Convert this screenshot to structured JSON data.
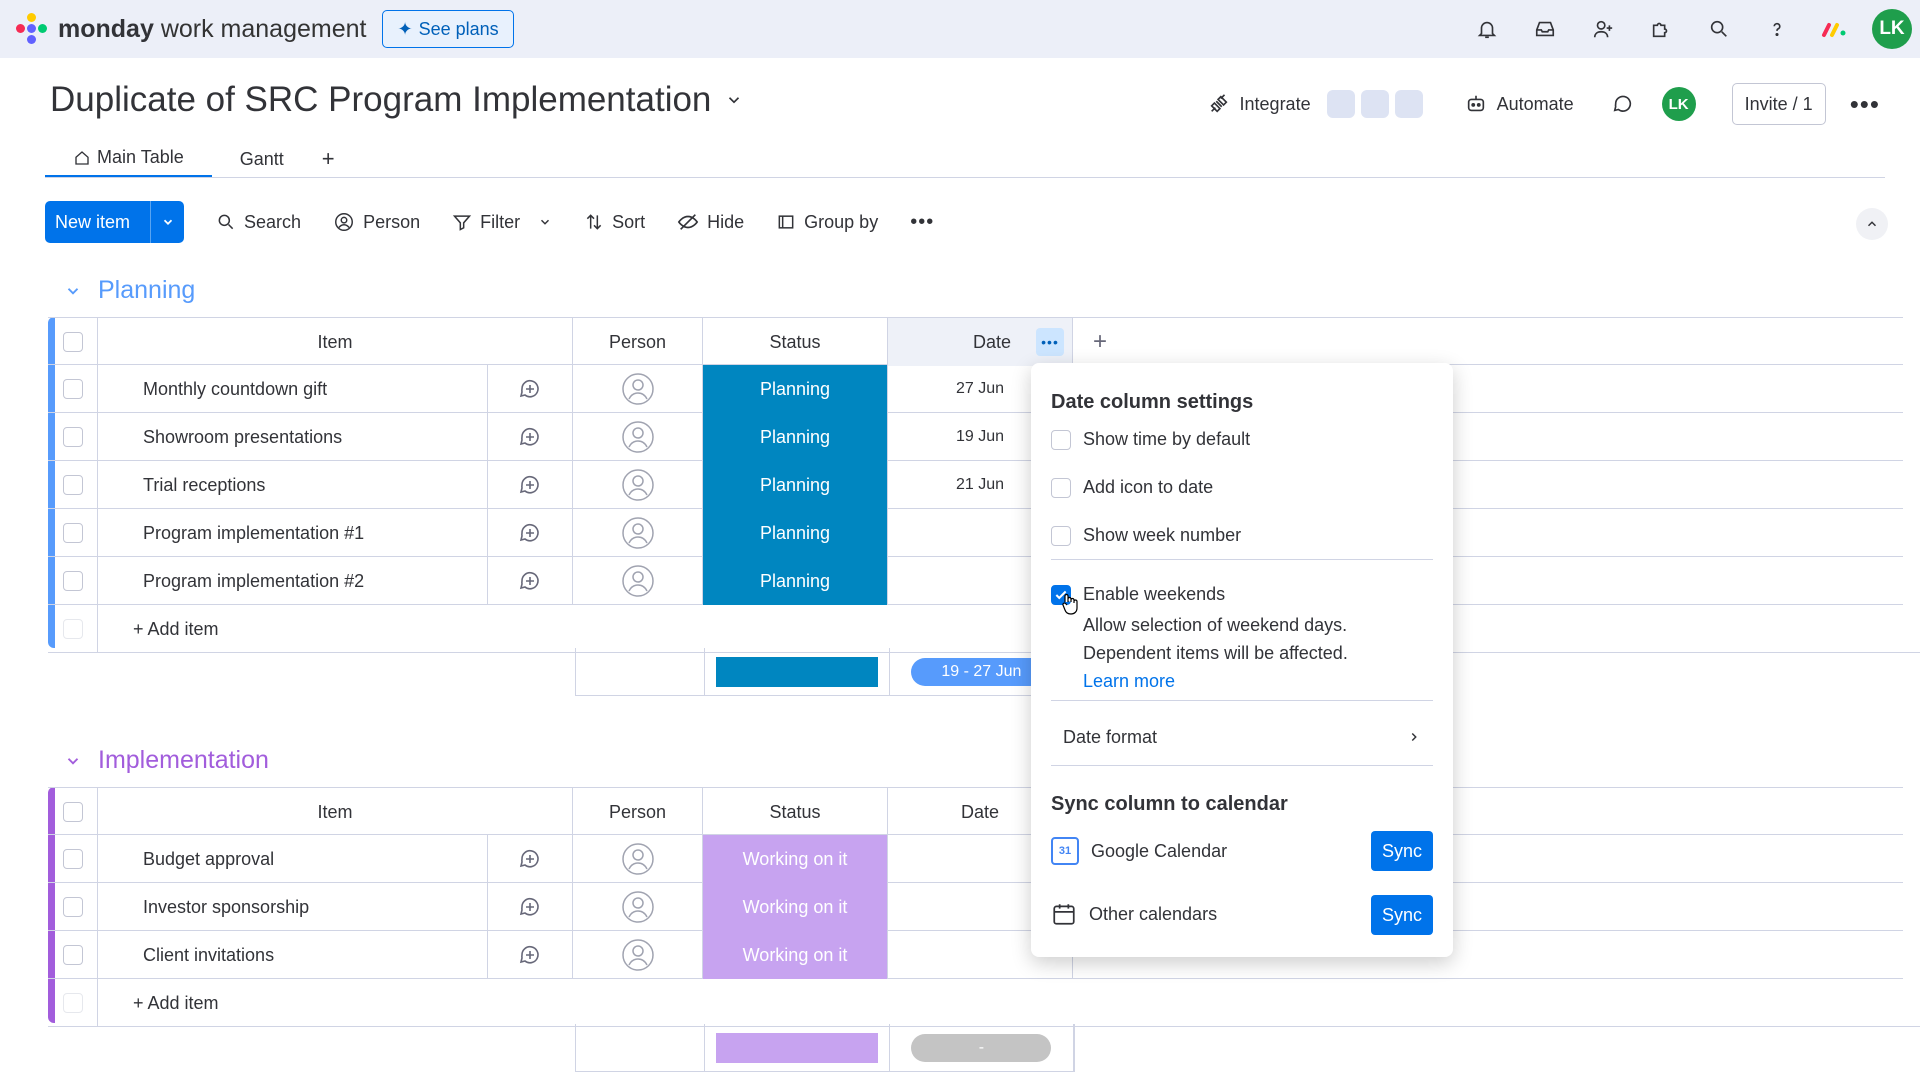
{
  "app": {
    "brand_bold": "monday",
    "brand_rest": "work management",
    "see_plans": "See plans",
    "user_initials": "LK"
  },
  "board": {
    "title": "Duplicate of SRC Program Implementation",
    "integrate": "Integrate",
    "automate": "Automate",
    "invite": "Invite / 1",
    "tabs": [
      {
        "label": "Main Table"
      },
      {
        "label": "Gantt"
      },
      {
        "label": "+"
      }
    ]
  },
  "toolbar": {
    "new_item": "New item",
    "search": "Search",
    "person": "Person",
    "filter": "Filter",
    "sort": "Sort",
    "hide": "Hide",
    "group_by": "Group by"
  },
  "columns": {
    "item": "Item",
    "person": "Person",
    "status": "Status",
    "date": "Date",
    "add": "+"
  },
  "groups": [
    {
      "title": "Planning",
      "color": "#579bfc",
      "rows": [
        {
          "item": "Monthly countdown gift",
          "status": "Planning",
          "date": "27 Jun"
        },
        {
          "item": "Showroom presentations",
          "status": "Planning",
          "date": "19 Jun"
        },
        {
          "item": "Trial receptions",
          "status": "Planning",
          "date": "21 Jun"
        },
        {
          "item": "Program implementation #1",
          "status": "Planning",
          "date": ""
        },
        {
          "item": "Program implementation #2",
          "status": "Planning",
          "date": ""
        }
      ],
      "status_color": "#0086c0",
      "add_item": "+ Add item",
      "date_summary": "19 - 27 Jun"
    },
    {
      "title": "Implementation",
      "color": "#a25ddc",
      "rows": [
        {
          "item": "Budget approval",
          "status": "Working on it",
          "date": ""
        },
        {
          "item": "Investor sponsorship",
          "status": "Working on it",
          "date": ""
        },
        {
          "item": "Client invitations",
          "status": "Working on it",
          "date": ""
        }
      ],
      "status_color": "#c7a3f0",
      "add_item": "+ Add item",
      "date_summary": "-"
    }
  ],
  "popup": {
    "title": "Date column settings",
    "options": [
      {
        "label": "Show time by default",
        "checked": false
      },
      {
        "label": "Add icon to date",
        "checked": false
      },
      {
        "label": "Show week number",
        "checked": false
      },
      {
        "label": "Enable weekends",
        "checked": true
      }
    ],
    "weekends_desc_1": "Allow selection of weekend days.",
    "weekends_desc_2": "Dependent items will be affected.",
    "learn_more": "Learn more",
    "date_format": "Date format",
    "sync_title": "Sync column to calendar",
    "google_calendar": "Google Calendar",
    "other_calendars": "Other calendars",
    "sync_label": "Sync",
    "google_cal_day": "31"
  }
}
